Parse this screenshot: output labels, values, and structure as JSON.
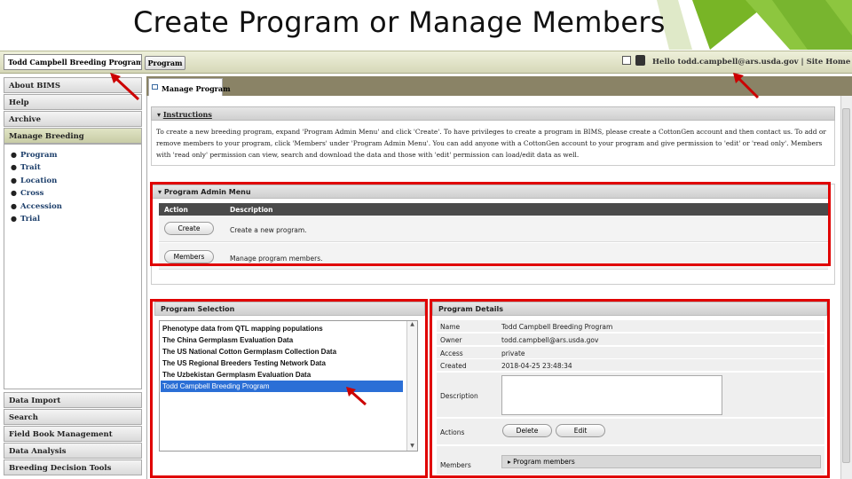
{
  "slide": {
    "title": "Create Program or Manage Members"
  },
  "topbar": {
    "program_select_value": "Todd Campbell Breeding Program",
    "program_button": "Program",
    "hello_text": "Hello todd.campbell@ars.usda.gov | Site Home | Log out"
  },
  "sidebar": {
    "items_top": [
      "About BIMS",
      "Help",
      "Archive",
      "Manage Breeding"
    ],
    "submenu": [
      "Program",
      "Trait",
      "Location",
      "Cross",
      "Accession",
      "Trial"
    ],
    "items_bottom": [
      "Data Import",
      "Search",
      "Field Book Management",
      "Data Analysis",
      "Breeding Decision Tools"
    ]
  },
  "tabs": {
    "manage_program": "Manage Program"
  },
  "instructions": {
    "header": "Instructions",
    "text": "To create a new breeding program, expand 'Program Admin Menu' and click 'Create'. To have privileges to create a program in BIMS, please create a CottonGen account and then contact us. To add or remove members to your program, click 'Members' under 'Program Admin Menu'. You can add anyone with a CottonGen account to your program and give permission to 'edit' or 'read only'. Members with 'read only' permission can view, search and download the data and those with 'edit' permission can load/edit data as well."
  },
  "admin_menu": {
    "header": "Program Admin Menu",
    "col_action": "Action",
    "col_description": "Description",
    "rows": [
      {
        "button": "Create",
        "description": "Create a new program."
      },
      {
        "button": "Members",
        "description": "Manage program members."
      }
    ]
  },
  "program_selection": {
    "header": "Program Selection",
    "items": [
      "Phenotype data from QTL mapping populations",
      "The China Germplasm Evaluation Data",
      "The US National Cotton Germplasm Collection Data",
      "The US Regional Breeders Testing Network Data",
      "The Uzbekistan Germplasm Evaluation Data",
      "Todd Campbell Breeding Program"
    ],
    "selected_index": 5
  },
  "program_details": {
    "header": "Program Details",
    "name_label": "Name",
    "name_value": "Todd Campbell Breeding Program",
    "owner_label": "Owner",
    "owner_value": "todd.campbell@ars.usda.gov",
    "access_label": "Access",
    "access_value": "private",
    "created_label": "Created",
    "created_value": "2018-04-25 23:48:34",
    "description_label": "Description",
    "actions_label": "Actions",
    "delete_button": "Delete",
    "edit_button": "Edit",
    "members_label": "Members",
    "program_members": "Program members"
  },
  "colors": {
    "highlight_red": "#e00000",
    "selection_blue": "#2b6fd6",
    "accent_green": "#8dc63f"
  }
}
